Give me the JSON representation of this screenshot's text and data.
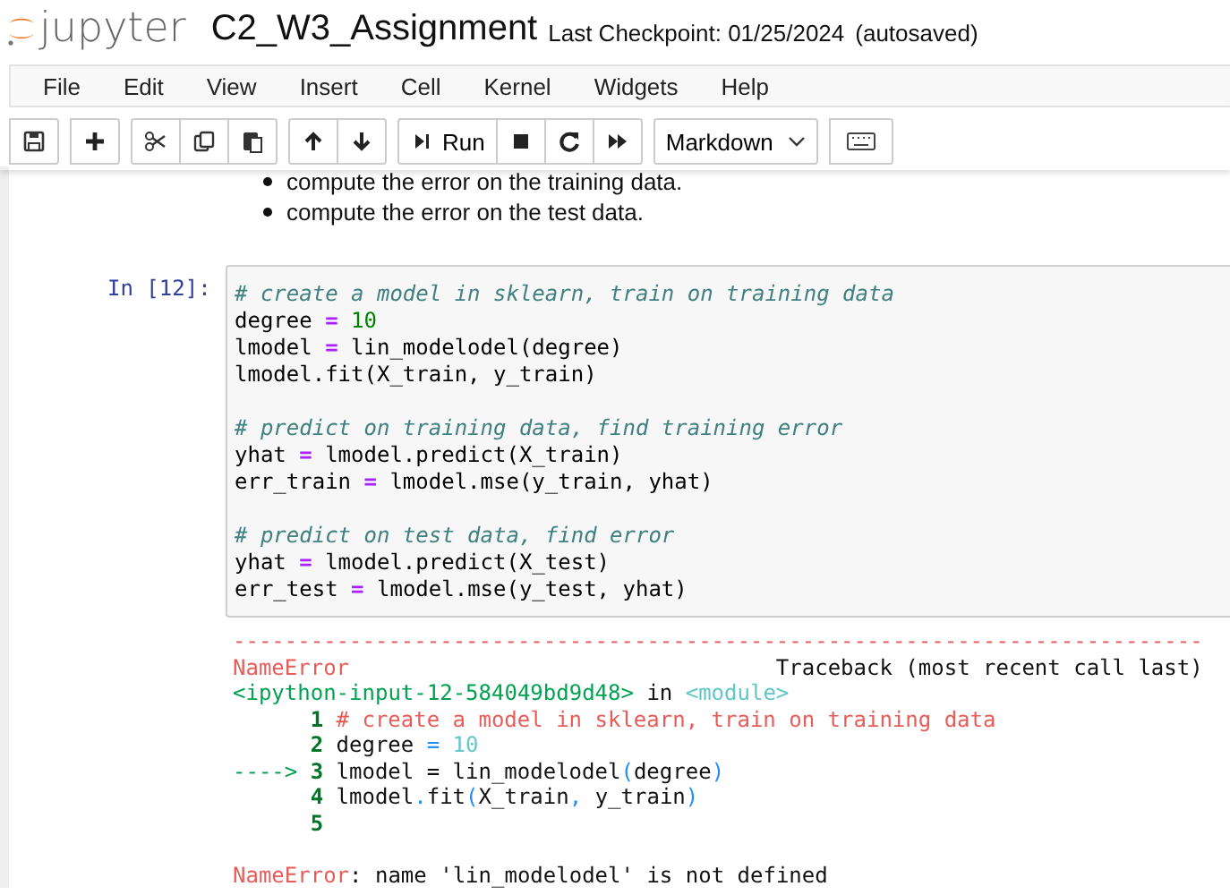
{
  "header": {
    "logo_text": "jupyter",
    "title": "C2_W3_Assignment",
    "checkpoint": "Last Checkpoint: 01/25/2024",
    "autosave": "(autosaved)"
  },
  "menu": [
    "File",
    "Edit",
    "View",
    "Insert",
    "Cell",
    "Kernel",
    "Widgets",
    "Help"
  ],
  "toolbar": [
    [
      {
        "kind": "save"
      }
    ],
    [
      {
        "kind": "add"
      }
    ],
    [
      {
        "kind": "cut"
      },
      {
        "kind": "copy"
      },
      {
        "kind": "paste"
      }
    ],
    [
      {
        "kind": "up"
      },
      {
        "kind": "down"
      }
    ],
    [
      {
        "kind": "run",
        "label": "Run"
      },
      {
        "kind": "stop"
      },
      {
        "kind": "restart"
      },
      {
        "kind": "fastforward"
      }
    ]
  ],
  "cell_type": "Markdown",
  "markdown_items": [
    "compute the error on the training data.",
    "compute the error on the test data."
  ],
  "cell": {
    "prompt": "In [12]:",
    "blocks": [
      [
        [
          {
            "kind": "comment",
            "text": "# create a model in sklearn, train on training data"
          }
        ],
        [
          {
            "kind": "plain",
            "text": "degree "
          },
          {
            "kind": "op",
            "text": "="
          },
          {
            "kind": "number",
            "text": " 10"
          }
        ],
        [
          {
            "kind": "plain",
            "text": "lmodel "
          },
          {
            "kind": "op",
            "text": "="
          },
          {
            "kind": "plain",
            "text": " lin_modelodel(degree)"
          }
        ],
        [
          {
            "kind": "plain",
            "text": "lmodel.fit(X_train, y_train)"
          }
        ]
      ],
      [
        [
          {
            "kind": "comment",
            "text": "# predict on training data, find training error"
          }
        ],
        [
          {
            "kind": "plain",
            "text": "yhat "
          },
          {
            "kind": "op",
            "text": "="
          },
          {
            "kind": "plain",
            "text": " lmodel.predict(X_train)"
          }
        ],
        [
          {
            "kind": "plain",
            "text": "err_train "
          },
          {
            "kind": "op",
            "text": "="
          },
          {
            "kind": "plain",
            "text": " lmodel.mse(y_train, yhat)"
          }
        ]
      ],
      [
        [
          {
            "kind": "comment",
            "text": "# predict on test data, find error"
          }
        ],
        [
          {
            "kind": "plain",
            "text": "yhat "
          },
          {
            "kind": "op",
            "text": "="
          },
          {
            "kind": "plain",
            "text": " lmodel.predict(X_test)"
          }
        ],
        [
          {
            "kind": "plain",
            "text": "err_test "
          },
          {
            "kind": "op",
            "text": "="
          },
          {
            "kind": "plain",
            "text": " lmodel.mse(y_test, yhat)"
          }
        ]
      ]
    ]
  },
  "traceback": {
    "rule": "---------------------------------------------------------------------------",
    "error_name": "NameError",
    "label": "Traceback (most recent call last)",
    "location": {
      "file": "<ipython-input-12-584049bd9d48>",
      "word": "in",
      "module": "<module>"
    },
    "lines": [
      {
        "number": "1",
        "tokens": [
          {
            "kind": "red",
            "text": "# create a model in sklearn, train on training data"
          }
        ]
      },
      {
        "number": "2",
        "tokens": [
          {
            "kind": "plain",
            "text": "degree "
          },
          {
            "kind": "blue",
            "text": "="
          },
          {
            "kind": "cyan",
            "text": " 10"
          }
        ]
      },
      {
        "arrow": "---->",
        "number": "3",
        "tokens": [
          {
            "kind": "plain",
            "text": "lmodel = lin_modelodel"
          },
          {
            "kind": "blue",
            "text": "("
          },
          {
            "kind": "plain",
            "text": "degree"
          },
          {
            "kind": "blue",
            "text": ")"
          }
        ]
      },
      {
        "number": "4",
        "tokens": [
          {
            "kind": "plain",
            "text": "lmodel"
          },
          {
            "kind": "blue",
            "text": "."
          },
          {
            "kind": "plain",
            "text": "fit"
          },
          {
            "kind": "blue",
            "text": "("
          },
          {
            "kind": "plain",
            "text": "X_train"
          },
          {
            "kind": "blue",
            "text": ","
          },
          {
            "kind": "plain",
            "text": " y_train"
          },
          {
            "kind": "blue",
            "text": ")"
          }
        ]
      },
      {
        "number": "5"
      }
    ],
    "message": {
      "name": "NameError",
      "text": ": name 'lin_modelodel' is not defined"
    }
  }
}
